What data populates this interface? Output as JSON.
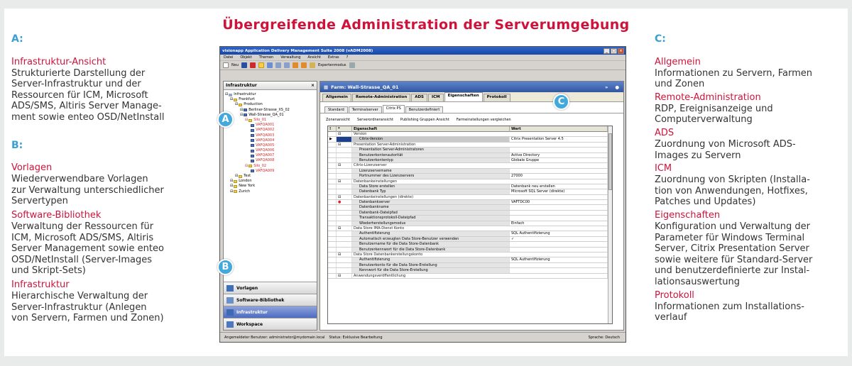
{
  "title": "Übergreifende Administration der Serverumgebung",
  "colors": {
    "accent_red": "#d0123a",
    "accent_blue": "#3aa0d2"
  },
  "left": {
    "section": "A:",
    "a_head": "Infrastruktur-Ansicht",
    "a_desc": [
      "Strukturierte Darstellung der",
      "Server-Infrastruktur und der",
      "Ressourcen für ICM, Microsoft",
      "ADS/SMS, Altiris Server Manage-",
      "ment sowie enteo OSD/NetInstall"
    ],
    "section_b": "B:",
    "items": [
      {
        "head": "Vorlagen",
        "desc": [
          "Wiederverwendbare Vorlagen",
          "zur Verwaltung unterschiedlicher",
          "Servertypen"
        ]
      },
      {
        "head": "Software-Bibliothek",
        "desc": [
          "Verwaltung der Ressourcen für",
          "ICM, Microsoft ADS/SMS, Altiris",
          "Server Management sowie enteo",
          "OSD/NetInstall (Server-Images",
          "und Skript-Sets)"
        ]
      },
      {
        "head": "Infrastruktur",
        "desc": [
          "Hierarchische Verwaltung der",
          "Server-Infrastruktur (Anlegen",
          "von Servern, Farmen und Zonen)"
        ]
      }
    ]
  },
  "right": {
    "section": "C:",
    "items": [
      {
        "head": "Allgemein",
        "desc": [
          "Informationen zu Servern, Farmen",
          "und Zonen"
        ]
      },
      {
        "head": "Remote-Administration",
        "desc": [
          "RDP, Ereignisanzeige und",
          "Computerverwaltung"
        ]
      },
      {
        "head": "ADS",
        "desc": [
          "Zuordnung von Microsoft ADS-",
          "Images zu Servern"
        ]
      },
      {
        "head": "ICM",
        "desc": [
          "Zuordnung von Skripten (Installa-",
          "tion von Anwendungen, Hotfixes,",
          "Patches und Updates)"
        ]
      },
      {
        "head": "Eigenschaften",
        "desc": [
          "Konfiguration und Verwaltung der",
          "Parameter für Windows Terminal",
          "Server, Citrix Presentation Server",
          "sowie weitere für Standard-Server",
          "und benutzerdefinierte zur Instal-",
          "lationsauswertung"
        ]
      },
      {
        "head": "Protokoll",
        "desc": [
          "Informationen zum Installations-",
          "verlauf"
        ]
      }
    ]
  },
  "markers": {
    "a": "A",
    "b": "B",
    "c": "C"
  },
  "app": {
    "window_title": "visionapp Application Delivery Management Suite 2008 (vADM2008)",
    "menu": [
      "Datei",
      "Objekt",
      "Themen",
      "Verwaltung",
      "Ansicht",
      "Extras",
      "?"
    ],
    "toolbar_new": "Neu",
    "toolbar_expert": "Expertenmodus",
    "left_header": "Infrastruktur",
    "tree": [
      {
        "label": "Infrastruktur",
        "indent": 0,
        "icon": "nt",
        "red": false
      },
      {
        "label": "Frankfurt",
        "indent": 1,
        "icon": "fd",
        "red": false
      },
      {
        "label": "Production",
        "indent": 2,
        "icon": "fd",
        "red": false
      },
      {
        "label": "Berliner-Strasse_XS_02",
        "indent": 3,
        "icon": "sv",
        "red": false
      },
      {
        "label": "Wall-Strasse_QA_01",
        "indent": 3,
        "icon": "sv",
        "red": false
      },
      {
        "label": "Silo_01",
        "indent": 4,
        "icon": "fd",
        "red": true
      },
      {
        "label": "VAFQA001",
        "indent": 5,
        "icon": "sv",
        "red": true
      },
      {
        "label": "VAFQA002",
        "indent": 5,
        "icon": "sv",
        "red": true
      },
      {
        "label": "VAFQA003",
        "indent": 5,
        "icon": "sv",
        "red": true
      },
      {
        "label": "VAFQA004",
        "indent": 5,
        "icon": "sv",
        "red": true
      },
      {
        "label": "VAFQA005",
        "indent": 5,
        "icon": "sv",
        "red": true
      },
      {
        "label": "VAFQA006",
        "indent": 5,
        "icon": "sv",
        "red": true
      },
      {
        "label": "VAFQA007",
        "indent": 5,
        "icon": "sv",
        "red": true
      },
      {
        "label": "VAFQA008",
        "indent": 5,
        "icon": "sv",
        "red": true
      },
      {
        "label": "Silo_02",
        "indent": 4,
        "icon": "fd",
        "red": true
      },
      {
        "label": "VAFQA009",
        "indent": 5,
        "icon": "sv",
        "red": true
      },
      {
        "label": "Test",
        "indent": 2,
        "icon": "fd",
        "red": false
      },
      {
        "label": "London",
        "indent": 1,
        "icon": "fd",
        "red": false
      },
      {
        "label": "New York",
        "indent": 1,
        "icon": "fd",
        "red": false
      },
      {
        "label": "Zurich",
        "indent": 1,
        "icon": "fd",
        "red": false
      }
    ],
    "nav_buttons": [
      {
        "label": "Vorlagen",
        "selected": false
      },
      {
        "label": "Software-Bibliothek",
        "selected": false
      },
      {
        "label": "Infrastruktur",
        "selected": true
      },
      {
        "label": "Workspace",
        "selected": false
      }
    ],
    "farm_header": "Farm: Wall-Strasse_QA_01",
    "tabs": [
      "Allgemein",
      "Remote-Administration",
      "ADS",
      "ICM",
      "Eigenschaften",
      "Protokoll"
    ],
    "active_tab": "Eigenschaften",
    "subtabs": [
      "Standard",
      "Terminalserver",
      "Citrix PS",
      "Benutzerdefiniert"
    ],
    "active_subtab": "Citrix PS",
    "grid_buttons": [
      "Zonenansicht",
      "Serverordneransicht",
      "Publishing Gruppen Ansicht",
      "Farmeinstellungen vergleichen"
    ],
    "grid_columns": [
      "!",
      "*",
      "Eigenschaft",
      "Wert"
    ],
    "grid_rows": [
      {
        "t": "cat",
        "p": "Version",
        "v": ""
      },
      {
        "t": "row",
        "p": "Citrix-Version",
        "v": "Citrix Presentation Server 4.5",
        "hl": true
      },
      {
        "t": "cat",
        "p": "Presentation Server-Administration",
        "v": ""
      },
      {
        "t": "row",
        "p": "Presentation Server-Administratoren",
        "v": ""
      },
      {
        "t": "row",
        "p": "Benutzerkontenautorität",
        "v": "Active Directory"
      },
      {
        "t": "row",
        "p": "Benutzerkontentyp",
        "v": "Globale Gruppe"
      },
      {
        "t": "cat",
        "p": "Citrix-Lizenzserver",
        "v": ""
      },
      {
        "t": "row",
        "p": "Lizenzservername",
        "v": ""
      },
      {
        "t": "row",
        "p": "Portnummer des Lizenzservers",
        "v": "27000"
      },
      {
        "t": "cat",
        "p": "Datenbankeinstellungen",
        "v": ""
      },
      {
        "t": "row",
        "p": "Data Store erstellen",
        "v": "Datenbank neu erstellen"
      },
      {
        "t": "row",
        "p": "Datenbank Typ",
        "v": "Microsoft SQL Server (direkte)"
      },
      {
        "t": "cat",
        "p": "Datenbankeinstellungen (direkte)",
        "v": ""
      },
      {
        "t": "row",
        "p": "Datenbankserver",
        "v": "VAFTDC00",
        "err": true
      },
      {
        "t": "row",
        "p": "Datenbankname",
        "v": ""
      },
      {
        "t": "row",
        "p": "Datenbank-Dateipfad",
        "v": ""
      },
      {
        "t": "row",
        "p": "Transaktionsprotokoll-Dateipfad",
        "v": ""
      },
      {
        "t": "row",
        "p": "Wiederherstellungsmodus",
        "v": "Einfach"
      },
      {
        "t": "cat",
        "p": "Data Store IMA-Dienst Konto",
        "v": ""
      },
      {
        "t": "row",
        "p": "Authentifizierung",
        "v": "SQL Authentifizierung"
      },
      {
        "t": "row",
        "p": "Automatisch erzeugten Data Store-Benutzer verwenden",
        "v": "✓"
      },
      {
        "t": "row",
        "p": "Benutzername für die Data Store-Datenbank",
        "v": ""
      },
      {
        "t": "row",
        "p": "Benutzerkennwort für die Data Store-Datenbank",
        "v": ""
      },
      {
        "t": "cat",
        "p": "Data Store Datenbankerstellungskonto",
        "v": ""
      },
      {
        "t": "row",
        "p": "Authentifizierung",
        "v": "SQL Authentifizierung"
      },
      {
        "t": "row",
        "p": "Benutzerkonto für die Data Store-Erstellung",
        "v": ""
      },
      {
        "t": "row",
        "p": "Kennwort für die Data Store-Erstellung",
        "v": ""
      },
      {
        "t": "cat",
        "p": "Anwendungsveröffentlichung",
        "v": ""
      }
    ],
    "status_user": "Angemeldeter Benutzer: administrator@mydomain.local",
    "status_state": "Status: Exklusive Bearbeitung",
    "status_lang": "Sprache: Deutsch"
  }
}
